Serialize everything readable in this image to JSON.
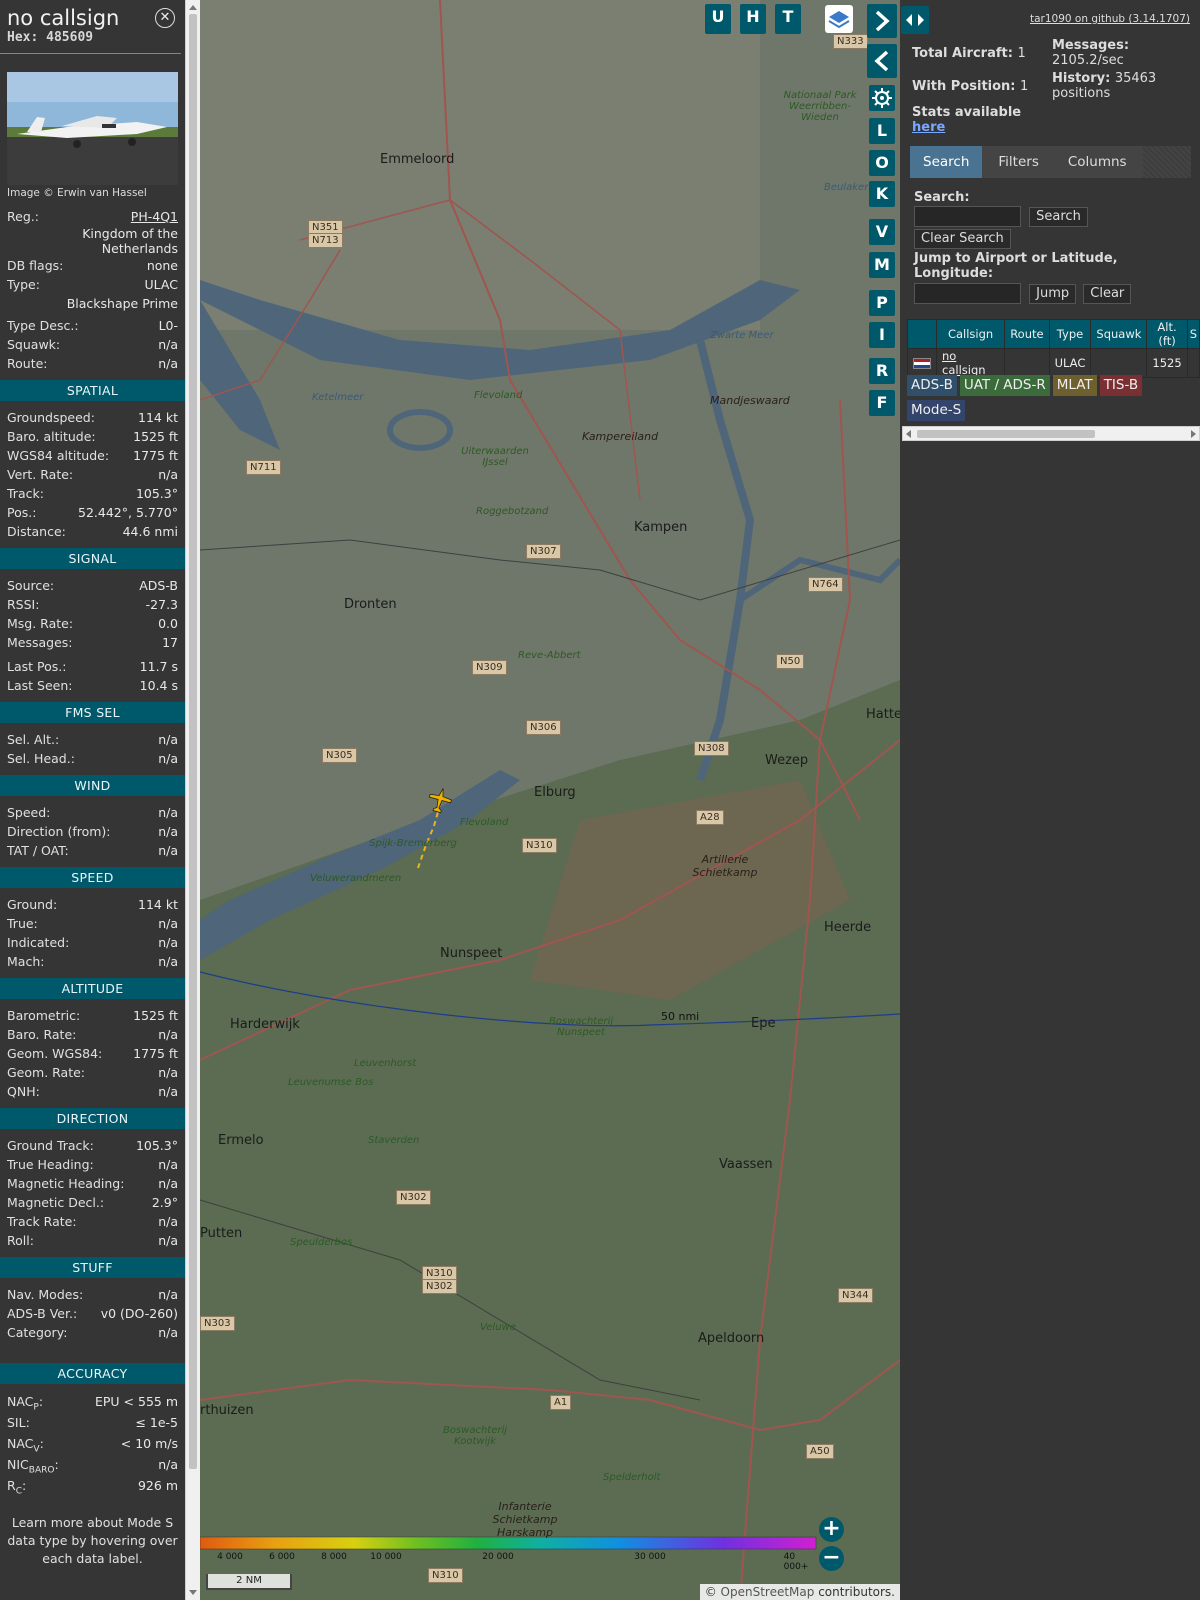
{
  "details": {
    "callsign": "no callsign",
    "hex": "Hex: 485609",
    "photo_credit": "Image © Erwin van Hassel",
    "reg_label": "Reg.:",
    "reg_value": "PH-4Q1",
    "country": "Kingdom of the Netherlands",
    "db_flags_label": "DB flags:",
    "db_flags_value": "none",
    "type_label": "Type:",
    "type_value": "ULAC",
    "model": "Blackshape Prime",
    "type_desc_label": "Type Desc.:",
    "type_desc_value": "L0-",
    "squawk_label": "Squawk:",
    "squawk_value": "n/a",
    "route_label": "Route:",
    "route_value": "n/a"
  },
  "sections": {
    "spatial": "SPATIAL",
    "signal": "SIGNAL",
    "fms": "FMS SEL",
    "wind": "WIND",
    "speed": "SPEED",
    "altitude": "ALTITUDE",
    "direction": "DIRECTION",
    "stuff": "STUFF",
    "accuracy": "ACCURACY"
  },
  "spatial": [
    {
      "k": "Groundspeed:",
      "v": "114 kt"
    },
    {
      "k": "Baro. altitude:",
      "v": "1525 ft"
    },
    {
      "k": "WGS84 altitude:",
      "v": "1775 ft"
    },
    {
      "k": "Vert. Rate:",
      "v": "n/a"
    },
    {
      "k": "Track:",
      "v": "105.3°"
    },
    {
      "k": "Pos.:",
      "v": "52.442°, 5.770°"
    },
    {
      "k": "Distance:",
      "v": "44.6 nmi"
    }
  ],
  "signal": [
    {
      "k": "Source:",
      "v": "ADS-B"
    },
    {
      "k": "RSSI:",
      "v": "-27.3"
    },
    {
      "k": "Msg. Rate:",
      "v": "0.0"
    },
    {
      "k": "Messages:",
      "v": "17"
    },
    {
      "k": "Last Pos.:",
      "v": "11.7 s"
    },
    {
      "k": "Last Seen:",
      "v": "10.4 s"
    }
  ],
  "fms": [
    {
      "k": "Sel. Alt.:",
      "v": "n/a"
    },
    {
      "k": "Sel. Head.:",
      "v": "n/a"
    }
  ],
  "wind": [
    {
      "k": "Speed:",
      "v": "n/a"
    },
    {
      "k": "Direction (from):",
      "v": "n/a"
    },
    {
      "k": "TAT / OAT:",
      "v": "n/a"
    }
  ],
  "speed": [
    {
      "k": "Ground:",
      "v": "114 kt"
    },
    {
      "k": "True:",
      "v": "n/a"
    },
    {
      "k": "Indicated:",
      "v": "n/a"
    },
    {
      "k": "Mach:",
      "v": "n/a"
    }
  ],
  "altitude": [
    {
      "k": "Barometric:",
      "v": "1525 ft"
    },
    {
      "k": "Baro. Rate:",
      "v": "n/a"
    },
    {
      "k": "Geom. WGS84:",
      "v": "1775 ft"
    },
    {
      "k": "Geom. Rate:",
      "v": "n/a"
    },
    {
      "k": "QNH:",
      "v": "n/a"
    }
  ],
  "direction": [
    {
      "k": "Ground Track:",
      "v": "105.3°"
    },
    {
      "k": "True Heading:",
      "v": "n/a"
    },
    {
      "k": "Magnetic Heading:",
      "v": "n/a"
    },
    {
      "k": "Magnetic Decl.:",
      "v": "2.9°"
    },
    {
      "k": "Track Rate:",
      "v": "n/a"
    },
    {
      "k": "Roll:",
      "v": "n/a"
    }
  ],
  "stuff": [
    {
      "k": "Nav. Modes:",
      "v": "n/a"
    },
    {
      "k": "ADS-B Ver.:",
      "v": "v0 (DO-260)"
    },
    {
      "k": "Category:",
      "v": "n/a"
    }
  ],
  "accuracy": [
    {
      "k": "NAC",
      "sub": "P",
      "v": "EPU < 555 m"
    },
    {
      "k": "SIL:",
      "sub": "",
      "v": "≤ 1e-5"
    },
    {
      "k": "NAC",
      "sub": "V",
      "v": "< 10 m/s"
    },
    {
      "k": "NIC",
      "sub": "BARO",
      "v": "n/a"
    },
    {
      "k": "R",
      "sub": "C",
      "v": "926 m"
    }
  ],
  "footer": "Learn more about Mode S data type by hovering over each data label.",
  "map": {
    "buttons_top": [
      "U",
      "H",
      "T"
    ],
    "buttons_side": [
      "L",
      "O",
      "K",
      "V",
      "M",
      "P",
      "I",
      "R",
      "F"
    ],
    "places": [
      {
        "t": "Emmeloord",
        "c": "big"
      },
      {
        "t": "Dronten",
        "c": "big"
      },
      {
        "t": "Kampen",
        "c": "big"
      },
      {
        "t": "Elburg",
        "c": "big"
      },
      {
        "t": "Hattem",
        "c": "big"
      },
      {
        "t": "Wezep",
        "c": "big"
      },
      {
        "t": "Nunspeet",
        "c": "big"
      },
      {
        "t": "Harderwijk",
        "c": "big"
      },
      {
        "t": "Ermelo",
        "c": "big"
      },
      {
        "t": "Epe",
        "c": "big"
      },
      {
        "t": "Heerde",
        "c": "big"
      },
      {
        "t": "Vaassen",
        "c": "big"
      },
      {
        "t": "Apeldoorn",
        "c": "big"
      },
      {
        "t": "Putten",
        "c": "big"
      },
      {
        "t": "rthuizen",
        "c": "big"
      },
      {
        "t": "Kampereiland",
        "c": "dark"
      },
      {
        "t": "Mandjeswaard",
        "c": "dark"
      },
      {
        "t": "Artillerie Schietkamp",
        "c": "dark"
      },
      {
        "t": "Infanterie Schietkamp Harskamp",
        "c": "dark"
      },
      {
        "t": "Ketelmeer",
        "c": "water"
      },
      {
        "t": "Zwarte Meer",
        "c": "water"
      },
      {
        "t": "Uiterwaarden IJssel",
        "c": "green"
      },
      {
        "t": "Roggebotzand",
        "c": "green"
      },
      {
        "t": "Reve-Abbert",
        "c": "green"
      },
      {
        "t": "Spijk-Bremerberg",
        "c": "green"
      },
      {
        "t": "Veluwerandmeren",
        "c": "green"
      },
      {
        "t": "Nationaal Park Weerribben-Wieden",
        "c": "green"
      },
      {
        "t": "Veluwe",
        "c": "green"
      },
      {
        "t": "Boswachterij Kootwijk",
        "c": "green"
      },
      {
        "t": "Boswachterij Nunspeet",
        "c": "green"
      },
      {
        "t": "Leuvenhorst",
        "c": "green"
      },
      {
        "t": "Leuvenumse Bos",
        "c": "green"
      },
      {
        "t": "Staverden",
        "c": "green"
      },
      {
        "t": "Speulderbos",
        "c": "green"
      },
      {
        "t": "Spelderholt",
        "c": "green"
      },
      {
        "t": "Flevoland",
        "c": "green"
      },
      {
        "t": "Flevoland",
        "c": "green"
      },
      {
        "t": "Beulaker",
        "c": "water"
      }
    ],
    "shields": [
      "N333",
      "N351",
      "N713",
      "N711",
      "N307",
      "N764",
      "N309",
      "N50",
      "N306",
      "N305",
      "N308",
      "A28",
      "N310",
      "N302",
      "N310",
      "N302",
      "N303",
      "N344",
      "A1",
      "A50",
      "N310"
    ],
    "range_label": "50 nmi",
    "scale": "2 NM",
    "attribution_prefix": "©",
    "attribution_link": "OpenStreetMap",
    "attribution_suffix": "contributors.",
    "altitude_ticks": [
      "4 000",
      "6 000",
      "8 000",
      "10 000",
      "20 000",
      "30 000",
      "40 000+"
    ]
  },
  "panel": {
    "github": "tar1090 on github (3.14.1707)",
    "total_label": "Total Aircraft:",
    "total_value": "1",
    "withpos_label": "With Position:",
    "withpos_value": "1",
    "stats_label": "Stats available",
    "stats_link": "here",
    "messages_label": "Messages:",
    "messages_value": "2105.2/sec",
    "history_label": "History:",
    "history_value": "35463",
    "history_unit": "positions",
    "tabs": [
      "Search",
      "Filters",
      "Columns"
    ],
    "search_label": "Search:",
    "search_button": "Search",
    "clear_search_button": "Clear Search",
    "jump_label": "Jump to Airport or Latitude, Longitude:",
    "jump_button": "Jump",
    "clear_button": "Clear",
    "columns": [
      "Callsign",
      "Route",
      "Type",
      "Squawk",
      "Alt. (ft)",
      "S"
    ],
    "rows": [
      {
        "callsign": "no callsign",
        "route": "",
        "type": "ULAC",
        "squawk": "",
        "alt": "1525",
        "s": ""
      }
    ],
    "legend": [
      {
        "t": "ADS-B",
        "color": "#2f4f6b"
      },
      {
        "t": "UAT / ADS-R",
        "color": "#3b6b3b"
      },
      {
        "t": "MLAT",
        "color": "#6e5f2e"
      },
      {
        "t": "TIS-B",
        "color": "#7a2f33"
      },
      {
        "t": "Mode-S",
        "color": "#34456b"
      }
    ]
  }
}
